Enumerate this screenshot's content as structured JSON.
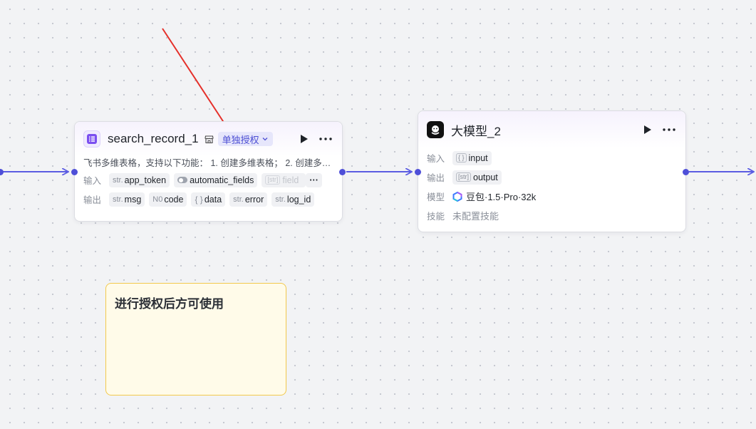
{
  "node1": {
    "title": "search_record_1",
    "auth_label": "单独授权",
    "description": "飞书多维表格，支持以下功能： 1. 创建多维表格； 2. 创建多…",
    "input_label": "输入",
    "output_label": "输出",
    "inputs": [
      {
        "type": "str.",
        "name": "app_token"
      },
      {
        "type": "toggle",
        "name": "automatic_fields"
      },
      {
        "type": "[str]",
        "name": "field"
      }
    ],
    "outputs": [
      {
        "type": "str.",
        "name": "msg"
      },
      {
        "type": "N0",
        "name": "code"
      },
      {
        "type": "{ }",
        "name": "data"
      },
      {
        "type": "str.",
        "name": "error"
      },
      {
        "type": "str.",
        "name": "log_id"
      }
    ],
    "more_inputs": "···"
  },
  "node2": {
    "title": "大模型_2",
    "input_label": "输入",
    "output_label": "输出",
    "model_label": "模型",
    "skill_label": "技能",
    "input_type": "{ }",
    "input_name": "input",
    "output_type": "[str]",
    "output_name": "output",
    "model_name": "豆包·1.5·Pro·32k",
    "skill_value": "未配置技能"
  },
  "note": {
    "text": "进行授权后方可使用"
  },
  "colors": {
    "edge": "#5b5ce2",
    "arrow": "#e5302a",
    "note_bg": "#fffbe9",
    "note_border": "#f2c94c",
    "badge_text": "#4d4fd4"
  },
  "icons": {
    "node1_icon": "table-icon",
    "node2_icon": "llm-icon",
    "run": "play-icon",
    "more": "more-icon"
  }
}
